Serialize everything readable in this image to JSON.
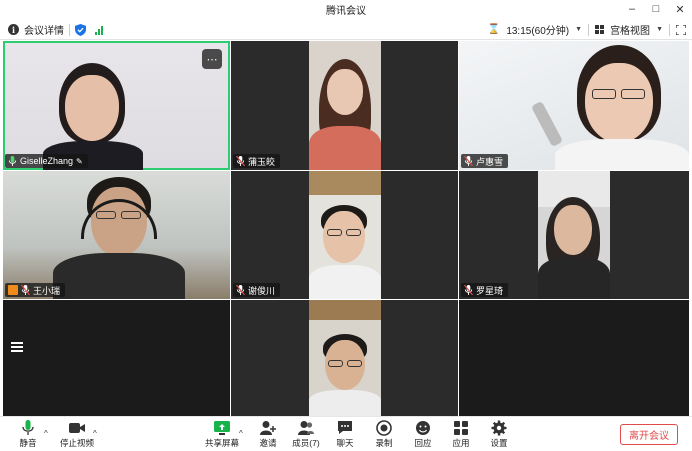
{
  "window": {
    "title": "腾讯会议"
  },
  "infobar": {
    "meeting_details_label": "会议详情",
    "timer": "13:15(60分钟)",
    "view_mode": "宫格视图"
  },
  "participants": [
    {
      "name": "GiselleZhang",
      "active": true
    },
    {
      "name": "蒲玉皎"
    },
    {
      "name": "卢惠雪"
    },
    {
      "name": "王小瑞"
    },
    {
      "name": "谢俊川"
    },
    {
      "name": "罗星琦"
    }
  ],
  "toolbar": {
    "mute_label": "静音",
    "stop_video_label": "停止视频",
    "share_screen_label": "共享屏幕",
    "invite_label": "邀请",
    "members_label": "成员(7)",
    "chat_label": "聊天",
    "record_label": "录制",
    "reactions_label": "回应",
    "apps_label": "应用",
    "settings_label": "设置",
    "leave_label": "离开会议"
  },
  "colors": {
    "active_speaker_border": "#2ecc71",
    "leave_red": "#e24b4b",
    "signal_green": "#18b34a",
    "shield_blue": "#1a73e8"
  }
}
